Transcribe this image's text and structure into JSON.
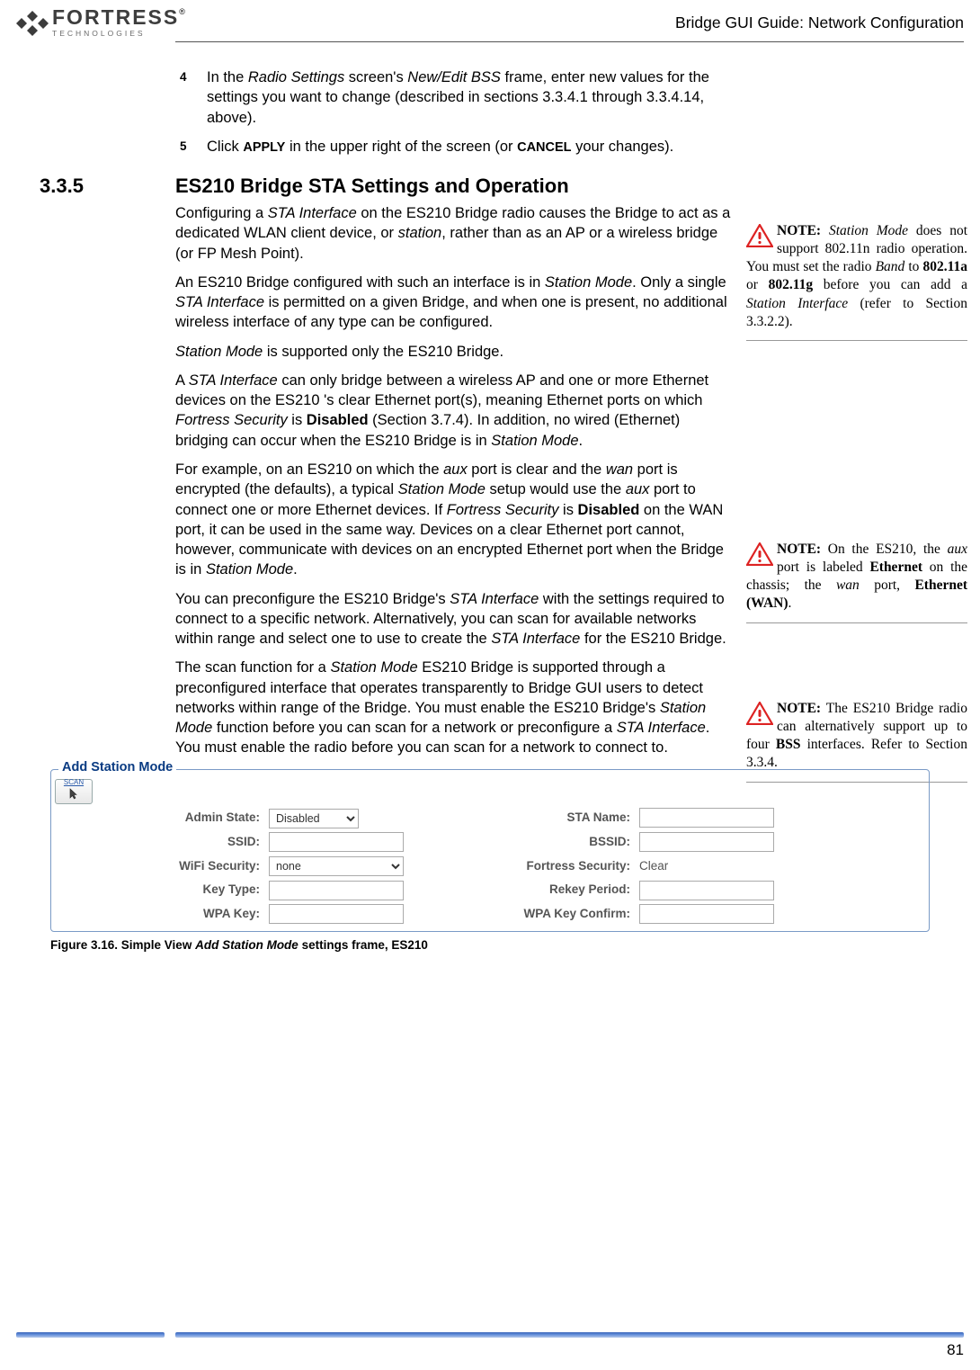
{
  "header": {
    "logo_main": "FORTRESS",
    "logo_reg": "®",
    "logo_sub": "TECHNOLOGIES",
    "title": "Bridge GUI Guide: Network Configuration"
  },
  "steps": {
    "s4_num": "4",
    "s4_a": "In the ",
    "s4_b": "Radio Settings",
    "s4_c": " screen's ",
    "s4_d": "New/Edit BSS",
    "s4_e": " frame, enter new values for the settings you want to change (described in sections 3.3.4.1 through 3.3.4.14, above).",
    "s5_num": "5",
    "s5_a": "Click ",
    "s5_b": "APPLY",
    "s5_c": " in the upper right of the screen (or ",
    "s5_d": "CANCEL",
    "s5_e": " your changes)."
  },
  "section": {
    "num": "3.3.5",
    "title": "ES210 Bridge STA Settings and Operation"
  },
  "body": {
    "p1a": "Configuring a ",
    "p1b": "STA Interface",
    "p1c": " on the ES210 Bridge radio causes the Bridge to act as a dedicated WLAN client device, or ",
    "p1d": "station",
    "p1e": ", rather than as an AP or a wireless bridge (or FP Mesh Point).",
    "p2a": "An ES210 Bridge configured with such an interface is in ",
    "p2b": "Station Mode",
    "p2c": ". Only a single ",
    "p2d": "STA Interface",
    "p2e": " is permitted on a given Bridge, and when one is present, no additional wireless interface of any type can be configured.",
    "p3a": "Station Mode",
    "p3b": " is supported only the ES210 Bridge.",
    "p4a": "A ",
    "p4b": "STA Interface",
    "p4c": " can only bridge between a wireless AP and one or more Ethernet devices on the ES210 's clear Ethernet port(s), meaning Ethernet ports on which ",
    "p4d": "Fortress Security",
    "p4e": " is ",
    "p4f": "Disabled",
    "p4g": " (Section 3.7.4). In addition, no wired (Ethernet) bridging can occur when the ES210 Bridge is in ",
    "p4h": "Station Mode",
    "p4i": ".",
    "p5a": "For example, on an ES210 on which the ",
    "p5b": "aux",
    "p5c": " port is clear and the ",
    "p5d": "wan",
    "p5e": " port is encrypted (the defaults), a typical ",
    "p5f": "Station Mode",
    "p5g": " setup would use the ",
    "p5h": "aux",
    "p5i": " port to connect one or more Ethernet devices. If ",
    "p5j": "Fortress Security",
    "p5k": " is ",
    "p5l": "Disabled",
    "p5m": " on the WAN port, it can be used in the same way. Devices on a clear Ethernet port cannot, however, communicate with devices on an encrypted Ethernet port when the Bridge is in ",
    "p5n": "Station Mode",
    "p5o": ".",
    "p6a": "You can preconfigure the ES210 Bridge's ",
    "p6b": "STA Interface",
    "p6c": " with the settings required to connect to a specific network. Alternatively, you can scan for available networks within range and select one to use to create the ",
    "p6d": "STA Interface",
    "p6e": " for the ES210 Bridge.",
    "p7a": "The scan function for a ",
    "p7b": "Station Mode",
    "p7c": " ES210 Bridge is supported through a preconfigured interface that operates transparently to Bridge GUI users to detect networks within range of the Bridge. You must enable the ES210 Bridge's ",
    "p7d": "Station Mode",
    "p7e": " function before you can scan for a network or preconfigure a ",
    "p7f": "STA Interface",
    "p7g": ". You must enable the radio before you can scan for a network to connect to."
  },
  "notes": {
    "n1a": "NOTE:",
    "n1b": " Station Mode",
    "n1c": " does not support 802.11n radio opera­tion. You must set the radio ",
    "n1d": "Band",
    "n1e": " to ",
    "n1f": "802.11a",
    "n1g": " or ",
    "n1h": "802.11g",
    "n1i": " before you can add a ",
    "n1j": "Station Interface",
    "n1k": " (refer to Section 3.3.2.2).",
    "n2a": "NOTE:",
    "n2b": " On the ES210, the ",
    "n2c": "aux",
    "n2d": " port is labeled ",
    "n2e": "Ethernet",
    "n2f": " on the chassis; the ",
    "n2g": "wan",
    "n2h": " port, ",
    "n2i": "Ethernet (WAN)",
    "n2j": ".",
    "n3a": "NOTE:",
    "n3b": " The ES210 Bridge radio can alternatively support up to four ",
    "n3c": "BSS",
    "n3d": " interfaces. Refer to Section 3.3.4."
  },
  "figure": {
    "legend": "Add Station Mode",
    "scan": "SCAN",
    "labels": {
      "admin": "Admin State:",
      "sta": "STA Name:",
      "ssid": "SSID:",
      "bssid": "BSSID:",
      "wifi": "WiFi Security:",
      "fort": "Fortress Security:",
      "fort_val": "Clear",
      "key": "Key Type:",
      "rekey": "Rekey Period:",
      "wpa": "WPA Key:",
      "wpac": "WPA Key Confirm:"
    },
    "admin_sel": "Disabled",
    "wifi_sel": "none",
    "caption_a": "Figure 3.16. Simple View ",
    "caption_b": "Add Station Mode",
    "caption_c": " settings frame, ES210"
  },
  "page_num": "81"
}
